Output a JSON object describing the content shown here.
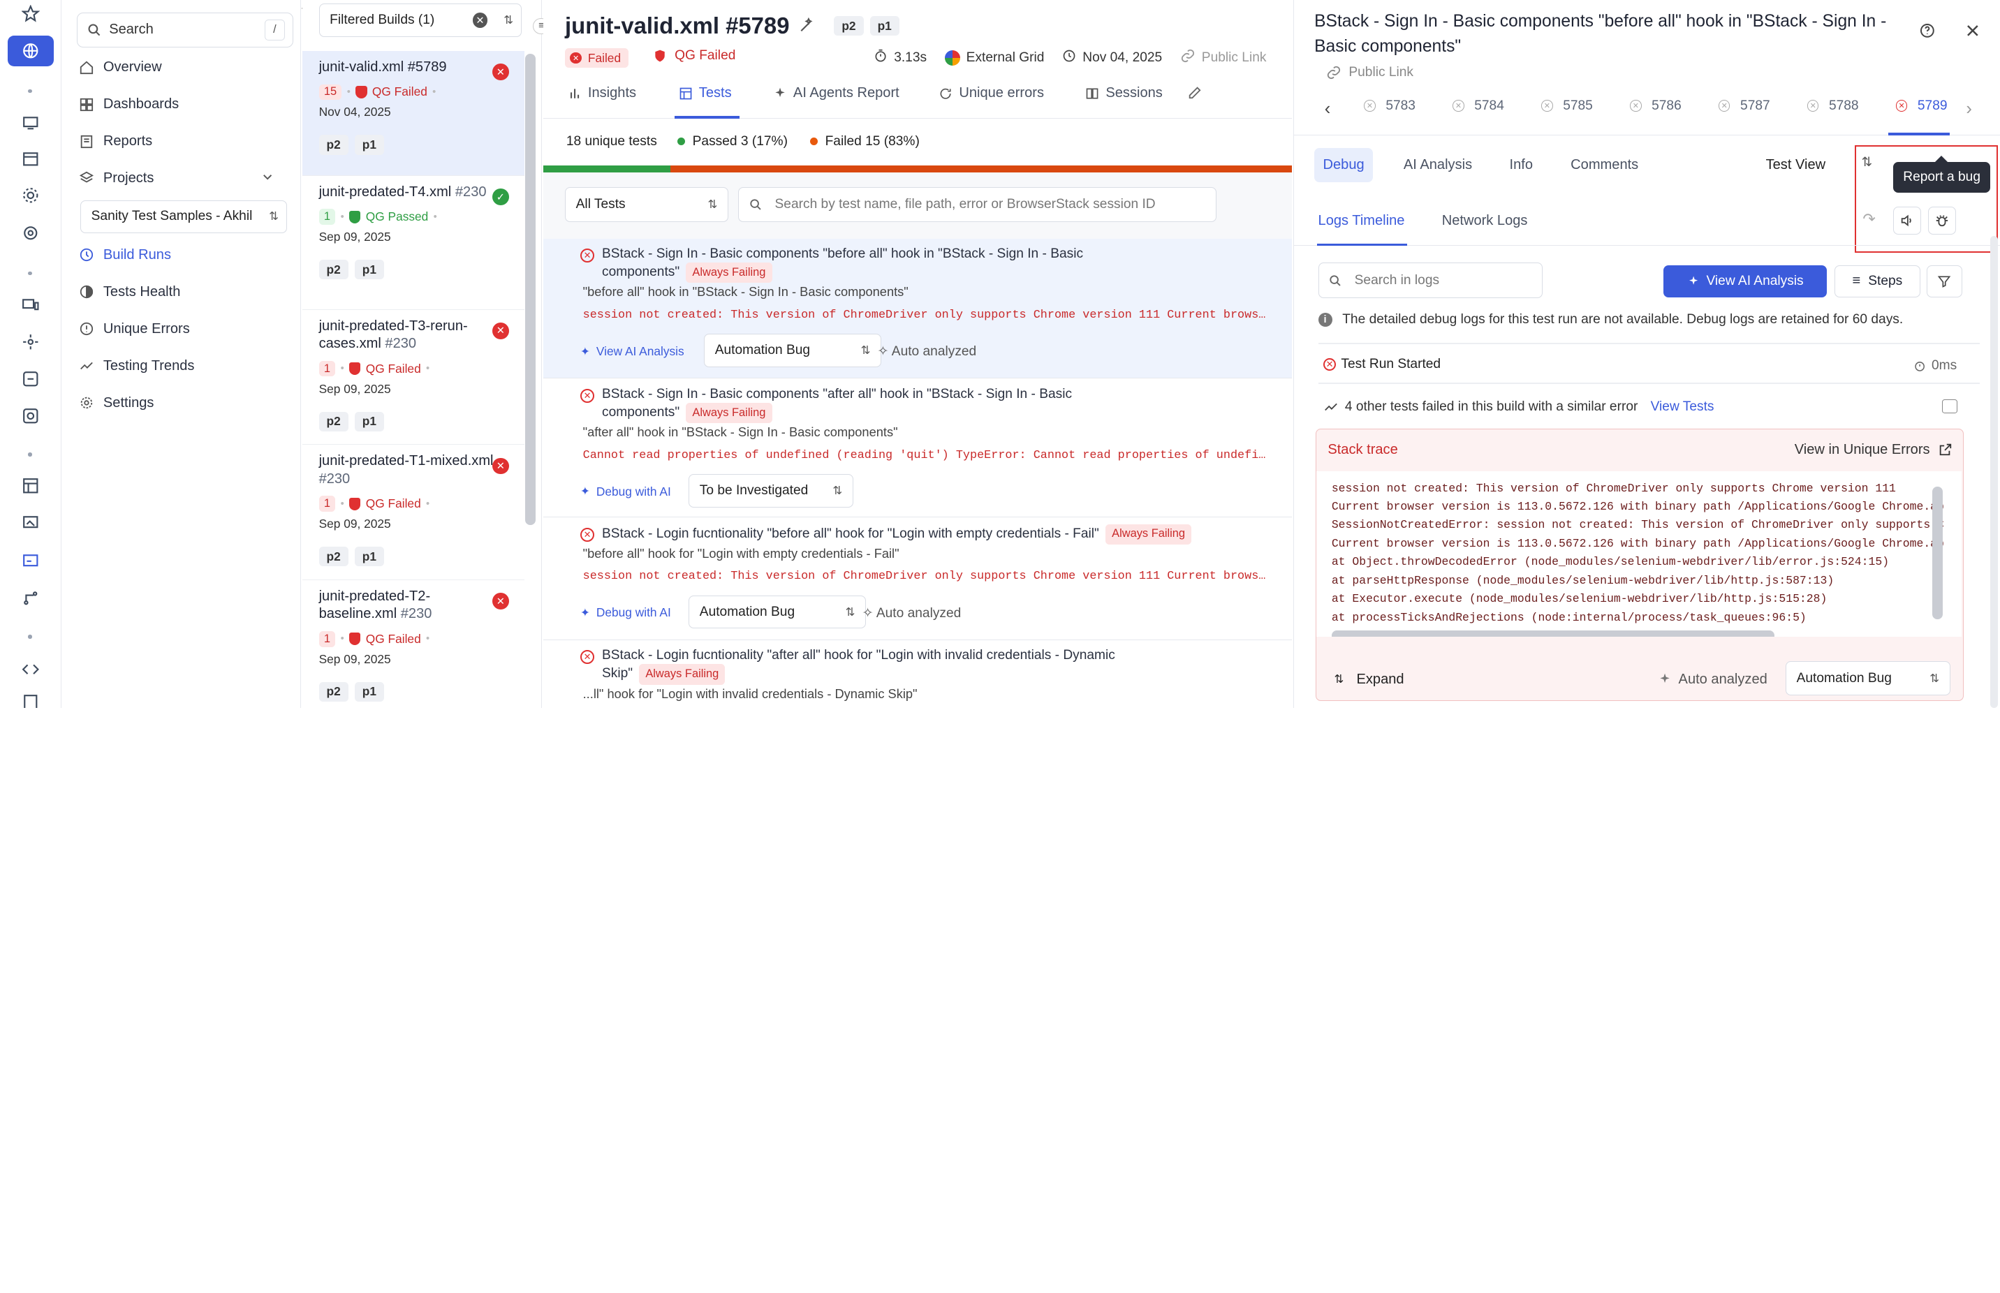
{
  "rail": {
    "icons": [
      "star-icon",
      "globe-icon",
      "monitor-icon",
      "calendar-icon",
      "cog-icon",
      "target-icon",
      "screens-icon",
      "settings-icon",
      "compare-icon",
      "refresh-icon",
      "grid-icon",
      "image-icon",
      "report-icon",
      "tree-icon",
      "code-icon",
      "building-icon"
    ]
  },
  "nav": {
    "search_placeholder": "Search",
    "search_key": "/",
    "overview": "Overview",
    "dashboards": "Dashboards",
    "reports": "Reports",
    "projects": "Projects",
    "project_select": "Sanity Test Samples - Akhil",
    "build_runs": "Build Runs",
    "tests_health": "Tests Health",
    "unique_errors": "Unique Errors",
    "testing_trends": "Testing Trends",
    "settings": "Settings"
  },
  "builds": {
    "filter": "Filtered Builds (1)",
    "items": [
      {
        "name": "junit-valid.xml #5789",
        "count": "15",
        "qg": "QG Failed",
        "date": "Nov 04, 2025",
        "tags": [
          "p2",
          "p1"
        ],
        "status": "failed"
      },
      {
        "name": "junit-predated-T4.xml",
        "num": "#230",
        "count": "1",
        "qg": "QG Passed",
        "date": "Sep 09, 2025",
        "tags": [
          "p2",
          "p1"
        ],
        "status": "passed"
      },
      {
        "name": "junit-predated-T3-rerun-cases.xml",
        "num": "#230",
        "count": "1",
        "qg": "QG Failed",
        "date": "Sep 09, 2025",
        "tags": [
          "p2",
          "p1"
        ],
        "status": "failed"
      },
      {
        "name": "junit-predated-T1-mixed.xml",
        "num": "#230",
        "count": "1",
        "qg": "QG Failed",
        "date": "Sep 09, 2025",
        "tags": [
          "p2",
          "p1"
        ],
        "status": "failed"
      },
      {
        "name": "junit-predated-T2-baseline.xml",
        "num": "#230",
        "count": "1",
        "qg": "QG Failed",
        "date": "Sep 09, 2025",
        "tags": [
          "p2",
          "p1"
        ],
        "status": "failed"
      }
    ]
  },
  "header": {
    "title": "junit-valid.xml",
    "number": "#5789",
    "tags": [
      "p2",
      "p1"
    ],
    "status": "Failed",
    "qg": "QG Failed",
    "duration": "3.13s",
    "grid": "External Grid",
    "date": "Nov 04, 2025",
    "public_link": "Public Link"
  },
  "tabs": {
    "insights": "Insights",
    "tests": "Tests",
    "ai_agents": "AI Agents Report",
    "unique_errors": "Unique errors",
    "sessions": "Sessions"
  },
  "summary": {
    "unique": "18 unique tests",
    "passed": "Passed 3 (17%)",
    "failed": "Failed 15 (83%)",
    "passed_fraction": 0.17
  },
  "filters": {
    "all_tests": "All Tests",
    "search_placeholder": "Search by test name, file path, error or BrowserStack session ID"
  },
  "tests": [
    {
      "title1": "BStack - Sign In - Basic components \"before all\" hook in \"BStack - Sign In - Basic",
      "title2": "components\"",
      "badge": "Always Failing",
      "sub": "\"before all\" hook in \"BStack - Sign In - Basic components\"",
      "error": "session not created: This version of ChromeDriver only supports Chrome version 111 Current brows…",
      "ai": "View AI Analysis",
      "category": "Automation Bug",
      "auto": "Auto analyzed"
    },
    {
      "title1": "BStack - Sign In - Basic components \"after all\" hook in \"BStack - Sign In - Basic",
      "title2": "components\"",
      "badge": "Always Failing",
      "sub": "\"after all\" hook in \"BStack - Sign In - Basic components\"",
      "error": "Cannot read properties of undefined (reading 'quit') TypeError: Cannot read properties of undefi…",
      "ai": "Debug with AI",
      "category": "To be Investigated"
    },
    {
      "title1": "BStack - Login fucntionality \"before all\" hook for \"Login with empty credentials - Fail\"",
      "badge": "Always Failing",
      "sub": "\"before all\" hook for \"Login with empty credentials - Fail\"",
      "error": "session not created: This version of ChromeDriver only supports Chrome version 111 Current brows…",
      "ai": "Debug with AI",
      "category": "Automation Bug",
      "auto": "Auto analyzed"
    },
    {
      "title1": "BStack - Login fucntionality \"after all\" hook for \"Login with invalid credentials - Dynamic",
      "title2": "Skip\"",
      "badge": "Always Failing",
      "sub": "...ll\" hook for \"Login with invalid credentials - Dynamic Skip\""
    }
  ],
  "panel": {
    "title": "BStack - Sign In - Basic components \"before all\" hook in \"BStack - Sign In - Basic components\"",
    "public_link": "Public Link",
    "runs": [
      "5783",
      "5784",
      "5785",
      "5786",
      "5787",
      "5788",
      "5789"
    ],
    "subtabs": {
      "debug": "Debug",
      "ai": "AI Analysis",
      "info": "Info",
      "comments": "Comments"
    },
    "view_select": "Test View",
    "tooltip": "Report a bug",
    "logtabs": {
      "timeline": "Logs Timeline",
      "network": "Network Logs"
    },
    "log_search": "Search in logs",
    "view_ai": "View AI Analysis",
    "steps": "Steps",
    "notice": "The detailed debug logs for this test run are not available. Debug logs are retained for 60 days.",
    "run_started": "Test Run Started",
    "run_time": "0ms",
    "similar": "4 other tests failed in this build with a similar error",
    "view_tests": "View Tests",
    "stack_title": "Stack trace",
    "view_unique": "View in Unique Errors",
    "stack": [
      "session not created: This version of ChromeDriver only supports Chrome version 111",
      "Current browser version is 113.0.5672.126 with binary path /Applications/Google Chrome.ap",
      "SessionNotCreatedError: session not created: This version of ChromeDriver only supports C",
      "Current browser version is 113.0.5672.126 with binary path /Applications/Google Chrome.ap",
      "    at Object.throwDecodedError (node_modules/selenium-webdriver/lib/error.js:524:15)",
      "    at parseHttpResponse (node_modules/selenium-webdriver/lib/http.js:587:13)",
      "    at Executor.execute (node_modules/selenium-webdriver/lib/http.js:515:28)",
      "    at processTicksAndRejections (node:internal/process/task_queues:96:5)"
    ],
    "expand": "Expand",
    "auto": "Auto analyzed",
    "category": "Automation Bug"
  },
  "colors": {
    "accent": "#3b5bdb",
    "fail": "#e03131",
    "pass": "#2f9e44",
    "warn": "#e8590c"
  }
}
